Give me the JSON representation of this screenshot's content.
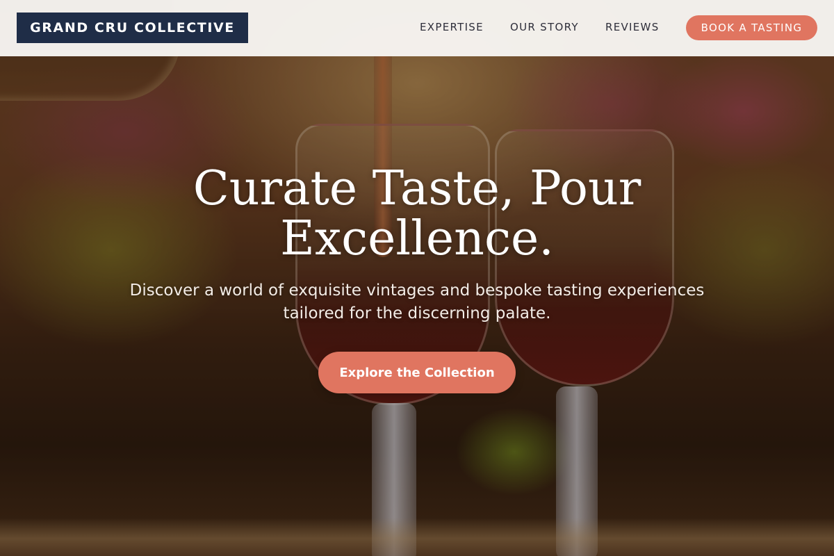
{
  "brand": {
    "name": "GRAND CRU COLLECTIVE",
    "logo_bg": "#1f2d47"
  },
  "nav": {
    "links": [
      "EXPERTISE",
      "OUR STORY",
      "REVIEWS"
    ],
    "cta_label": "BOOK A TASTING"
  },
  "hero": {
    "title_line1": "Curate Taste, Pour",
    "title_line2": "Excellence.",
    "subtitle_line1": "Discover a world of exquisite vintages and bespoke tasting experiences",
    "subtitle_line2": "tailored for the discerning palate.",
    "cta_label": "Explore the Collection",
    "background_image": "wine-glasses-pour-photo"
  },
  "colors": {
    "accent": "#e07560",
    "navbar_bg": "#f8f6f2",
    "nav_text": "#2e2e3a"
  }
}
